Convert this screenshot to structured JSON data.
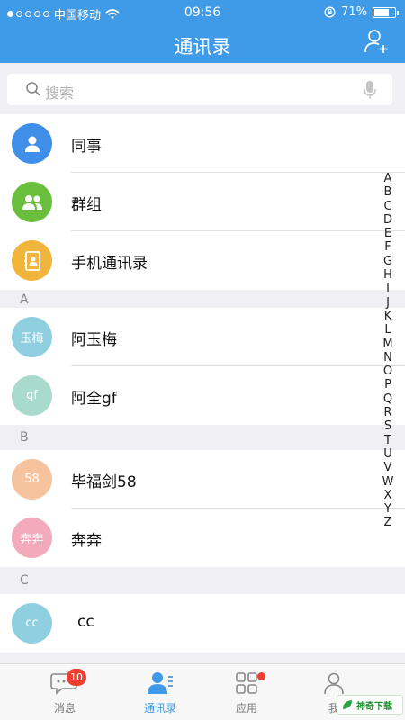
{
  "status": {
    "carrier": "中国移动",
    "time": "09:56",
    "battery": "71%",
    "battery_level": 0.71
  },
  "header": {
    "title": "通讯录"
  },
  "search": {
    "placeholder": "搜索"
  },
  "top_items": [
    {
      "label": "同事",
      "icon": "colleague-icon",
      "color": "#3f8ee8"
    },
    {
      "label": "群组",
      "icon": "group-icon",
      "color": "#69bf3b"
    },
    {
      "label": "手机通讯录",
      "icon": "phone-contacts-icon",
      "color": "#f1b53c"
    }
  ],
  "sections": [
    {
      "letter": "A",
      "contacts": [
        {
          "avatar_text": "玉梅",
          "name": "阿玉梅",
          "color": "#8fcfe0"
        },
        {
          "avatar_text": "gf",
          "name": "阿全gf",
          "color": "#a9dbcc"
        }
      ]
    },
    {
      "letter": "B",
      "contacts": [
        {
          "avatar_text": "58",
          "name": "毕福剑58",
          "color": "#f5c49e"
        },
        {
          "avatar_text": "奔奔",
          "name": "奔奔",
          "color": "#f3aabb"
        }
      ]
    },
    {
      "letter": "C",
      "contacts": [
        {
          "avatar_text": "cc",
          "name": "cc",
          "color": "#8fcfe0"
        }
      ]
    }
  ],
  "index_letters": [
    "A",
    "B",
    "C",
    "D",
    "E",
    "F",
    "G",
    "H",
    "I",
    "J",
    "K",
    "L",
    "M",
    "N",
    "O",
    "P",
    "Q",
    "R",
    "S",
    "T",
    "U",
    "V",
    "W",
    "X",
    "Y",
    "Z"
  ],
  "tabs": [
    {
      "label": "消息",
      "badge": "10",
      "icon": "message-icon"
    },
    {
      "label": "通讯录",
      "icon": "contacts-icon",
      "active": true
    },
    {
      "label": "应用",
      "icon": "apps-icon",
      "dot": true
    },
    {
      "label": "我",
      "icon": "profile-icon"
    }
  ],
  "watermark": {
    "text": "神奇下载"
  },
  "colors": {
    "brand": "#3f9ae8",
    "badge": "#ee3e2f"
  }
}
